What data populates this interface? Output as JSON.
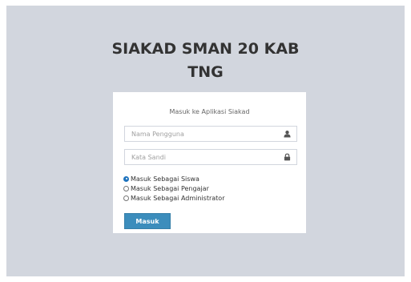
{
  "login": {
    "title_line1": "SIAKAD SMAN 20 KAB",
    "title_line2": "TNG",
    "box_message": "Masuk ke Aplikasi Siakad",
    "username": {
      "placeholder": "Nama Pengguna",
      "value": "",
      "icon": "user-icon"
    },
    "password": {
      "placeholder": "Kata Sandi",
      "value": "",
      "icon": "lock-icon"
    },
    "roles": [
      {
        "label": "Masuk Sebagai Siswa",
        "checked": true
      },
      {
        "label": "Masuk Sebagai Pengajar",
        "checked": false
      },
      {
        "label": "Masuk Sebagai Administrator",
        "checked": false
      }
    ],
    "submit_label": "Masuk"
  },
  "colors": {
    "page_background": "#d2d6de",
    "box_background": "#ffffff",
    "button": "#3c8dbc"
  }
}
